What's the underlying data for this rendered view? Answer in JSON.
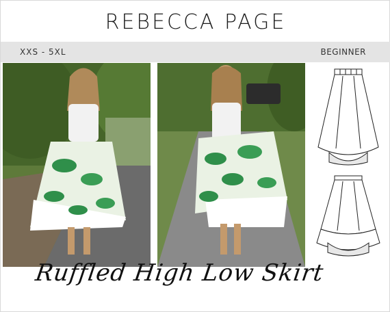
{
  "brand": {
    "name": "Rebecca Page"
  },
  "info_bar": {
    "size_range": "XXS - 5XL",
    "level": "BEGINNER"
  },
  "product": {
    "title": "Ruffled High Low Skirt"
  },
  "colors": {
    "info_bar_bg": "#e4e4e4",
    "text": "#1b1b1b",
    "print_green": "#2f8f4a"
  }
}
